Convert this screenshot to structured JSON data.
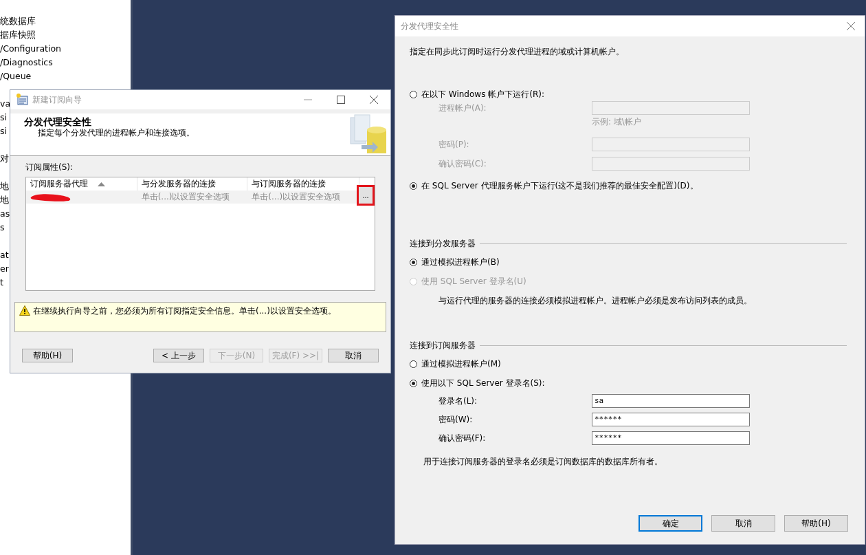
{
  "background_list": {
    "groups": [
      {
        "items": [
          "统数据库",
          "据库快照",
          "/Configuration",
          "/Diagnostics",
          "/Queue"
        ]
      },
      {
        "items": [
          "va",
          "si",
          "si"
        ]
      },
      {
        "items": [
          "对"
        ]
      },
      {
        "items": [
          "地",
          "地",
          "as",
          "s"
        ]
      },
      {
        "items": [
          "at",
          "er",
          "t"
        ]
      }
    ]
  },
  "wizard": {
    "title": "新建订阅向导",
    "heading": "分发代理安全性",
    "subheading": "指定每个分发代理的进程帐户和连接选项。",
    "list_label": "订阅属性(S):",
    "columns": [
      {
        "label": "订阅服务器代理",
        "sorted": true
      },
      {
        "label": "与分发服务器的连接",
        "sorted": false
      },
      {
        "label": "与订阅服务器的连接",
        "sorted": false
      }
    ],
    "rows": [
      {
        "redacted": true,
        "distributor_connection": "单击(...)以设置安全选项",
        "subscriber_connection": "单击(...)以设置安全选项",
        "ellipsis": {
          "label": "...",
          "highlighted": true
        }
      }
    ],
    "warning": "在继续执行向导之前，您必须为所有订阅指定安全信息。单击(...)以设置安全选项。",
    "buttons": [
      {
        "label": "帮助(H)",
        "disabled": false,
        "kind": "left"
      },
      {
        "label": "< 上一步",
        "disabled": false,
        "kind": "right"
      },
      {
        "label": "下一步(N)",
        "disabled": true,
        "kind": "right"
      },
      {
        "label": "完成(F) >>|",
        "disabled": true,
        "kind": "right"
      },
      {
        "label": "取消",
        "disabled": false,
        "kind": "right"
      }
    ]
  },
  "dialog": {
    "title": "分发代理安全性",
    "description": "指定在同步此订阅时运行分发代理进程的域或计算机帐户。",
    "process_options": [
      {
        "label": "在以下 Windows 帐户下运行(R):",
        "selected": false,
        "disabled": false,
        "fields": [
          {
            "label": "进程帐户(A):",
            "disabled": true,
            "hint": "示例: 域\\帐户"
          },
          {
            "label": "密码(P):",
            "disabled": true
          },
          {
            "label": "确认密码(C):",
            "disabled": true
          }
        ]
      },
      {
        "label": "在 SQL Server 代理服务帐户下运行(这不是我们推荐的最佳安全配置)(D)。",
        "selected": true,
        "disabled": false
      }
    ],
    "sections": [
      {
        "title": "连接到分发服务器",
        "options": [
          {
            "label": "通过模拟进程帐户(B)",
            "selected": true,
            "disabled": false
          },
          {
            "label": "使用 SQL Server 登录名(U)",
            "selected": false,
            "disabled": true
          }
        ],
        "note": "与运行代理的服务器的连接必须模拟进程帐户。进程帐户必须是发布访问列表的成员。"
      },
      {
        "title": "连接到订阅服务器",
        "options": [
          {
            "label": "通过模拟进程帐户(M)",
            "selected": false,
            "disabled": false
          },
          {
            "label": "使用以下 SQL Server 登录名(S):",
            "selected": true,
            "disabled": false,
            "fields": [
              {
                "label": "登录名(L):",
                "disabled": false,
                "value": "sa"
              },
              {
                "label": "密码(W):",
                "disabled": false,
                "value": "******"
              },
              {
                "label": "确认密码(F):",
                "disabled": false,
                "value": "******"
              }
            ]
          }
        ],
        "footnote": "用于连接订阅服务器的登录名必须是订阅数据库的数据库所有者。"
      }
    ],
    "buttons": [
      {
        "label": "确定",
        "default": true
      },
      {
        "label": "取消",
        "default": false
      },
      {
        "label": "帮助(H)",
        "default": false
      }
    ]
  }
}
